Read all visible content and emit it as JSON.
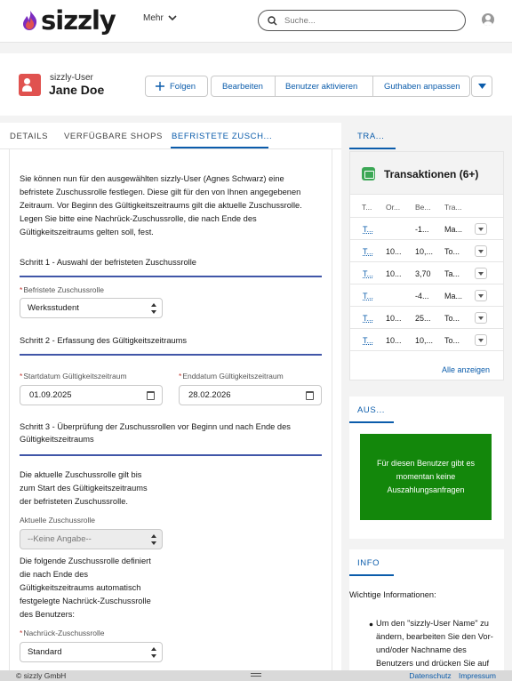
{
  "app": {
    "logo_text": "sizzly",
    "nav_more": "Mehr",
    "search_placeholder": "Suche..."
  },
  "header": {
    "type": "sizzly-User",
    "name": "Jane Doe",
    "actions": {
      "follow": "Folgen",
      "edit": "Bearbeiten",
      "activate": "Benutzer aktivieren",
      "credit": "Guthaben anpassen"
    }
  },
  "tabs": {
    "details": "DETAILS",
    "shops": "VERFÜGBARE SHOPS",
    "temp": "BEFRISTETE ZUSCH..."
  },
  "form": {
    "intro": [
      "Sie können nun für den ausgewählten sizzly-User (Agnes Schwarz) eine",
      "befristete Zuschussrolle festlegen. Diese gilt für den von Ihnen angegebenen",
      "Zeitraum. Vor Beginn des Gültigkeitszeitraums gilt die aktuelle Zuschussrolle.",
      "Legen Sie bitte eine Nachrück-Zuschussrolle, die nach Ende des",
      "Gültigkeitszeitraums gelten soll, fest."
    ],
    "step1": "Schritt 1 - Auswahl der befristeten Zuschussrolle",
    "temp_role_label": "Befristete Zuschussrolle",
    "temp_role_value": "Werksstudent",
    "step2": "Schritt 2 - Erfassung des Gültigkeitszeitraums",
    "start_label": "Startdatum Gültigkeitszeitraum",
    "start_value": "01.09.2025",
    "end_label": "Enddatum Gültigkeitszeitraum",
    "end_value": "28.02.2026",
    "step3_lines": [
      "Schritt 3 - Überprüfung der Zuschussrollen vor Beginn und nach Ende des",
      "Gültigkeitszeitraums"
    ],
    "current_text": [
      "Die aktuelle Zuschussrolle gilt bis",
      "zum Start des Gültigkeitszeitraums",
      "der befristeten Zuschussrolle."
    ],
    "current_label": "Aktuelle Zuschussrolle",
    "current_value": "--Keine Angabe--",
    "following_text": [
      "Die folgende Zuschussrolle definiert",
      "die nach Ende des",
      "Gültigkeitszeitraums automatisch",
      "festgelegte Nachrück-Zuschussrolle",
      "des Benutzers:"
    ],
    "succ_label": "Nachrück-Zuschussrolle",
    "succ_value": "Standard",
    "required_mark": "*"
  },
  "transactions": {
    "tab": "TRA...",
    "title": "Transaktionen (6+)",
    "columns": [
      "T...",
      "Or...",
      "Be...",
      "Tra..."
    ],
    "rows": [
      [
        "T...",
        "",
        "-1...",
        "Ma..."
      ],
      [
        "T...",
        "10...",
        "10,...",
        "To..."
      ],
      [
        "T...",
        "10...",
        "3,70",
        "Ta..."
      ],
      [
        "T...",
        "",
        "-4...",
        "Ma..."
      ],
      [
        "T...",
        "10...",
        "25...",
        "To..."
      ],
      [
        "T...",
        "10...",
        "10,...",
        "To..."
      ]
    ],
    "show_all": "Alle anzeigen"
  },
  "payouts": {
    "tab": "AUS...",
    "empty": "Für diesen Benutzer gibt es momentan keine Auszahlungsanfragen"
  },
  "info": {
    "tab": "INFO",
    "heading": "Wichtige Informationen:",
    "bullet_lines": [
      "Um den \"sizzly-User Name\" zu",
      "ändern, bearbeiten Sie den Vor-",
      "und/oder Nachname des",
      "Benutzers und drücken Sie auf"
    ]
  },
  "footer": {
    "copyright": "© sizzly GmbH",
    "privacy": "Datenschutz",
    "imprint": "Impressum"
  },
  "colors": {
    "brand_red": "#e0524f",
    "accent_blue": "#0b5cab",
    "step_line": "#4156a8",
    "payout_green": "#13870b"
  }
}
